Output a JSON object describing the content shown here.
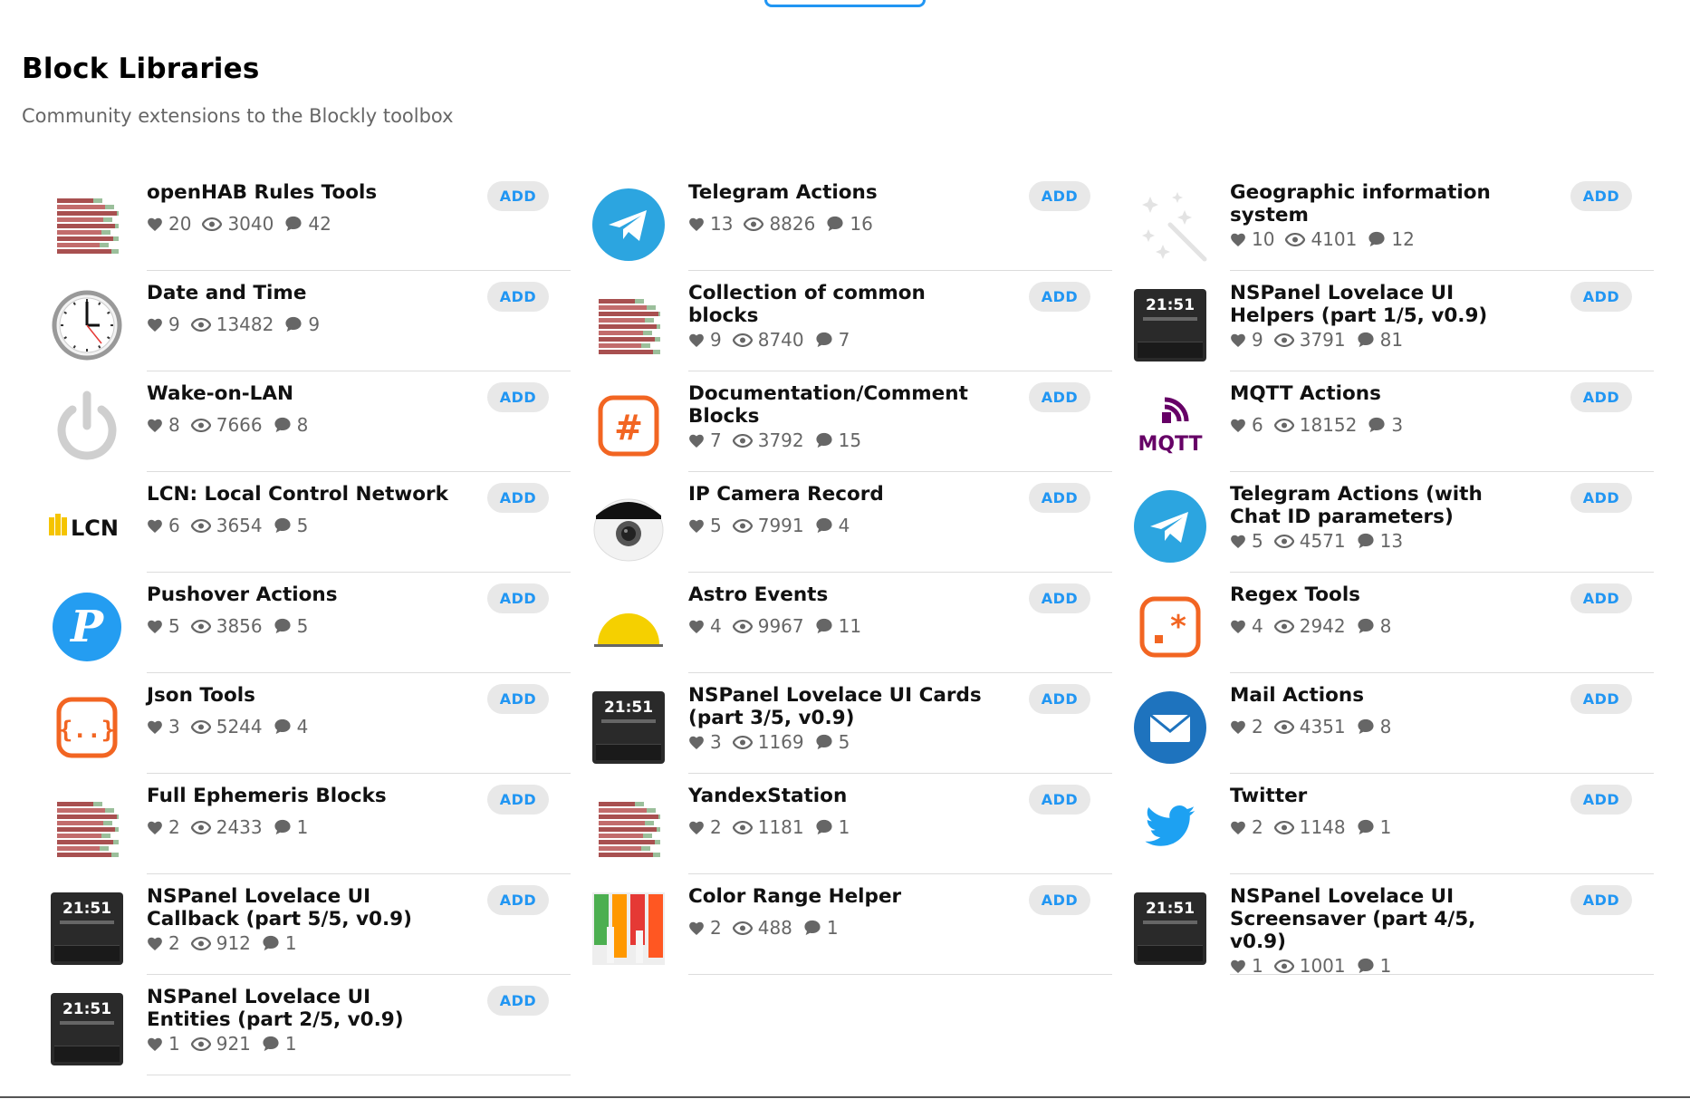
{
  "header": {
    "title": "Block Libraries",
    "subtitle": "Community extensions to the Blockly toolbox"
  },
  "add_label": "ADD",
  "columns": [
    [
      {
        "name": "openHAB Rules Tools",
        "likes": "20",
        "views": "3040",
        "comments": "42",
        "icon": "blocks-icon"
      },
      {
        "name": "Date and Time",
        "likes": "9",
        "views": "13482",
        "comments": "9",
        "icon": "clock-icon"
      },
      {
        "name": "Wake-on-LAN",
        "likes": "8",
        "views": "7666",
        "comments": "8",
        "icon": "power-icon"
      },
      {
        "name": "LCN: Local Control Network",
        "likes": "6",
        "views": "3654",
        "comments": "5",
        "icon": "lcn-logo-icon"
      },
      {
        "name": "Pushover Actions",
        "likes": "5",
        "views": "3856",
        "comments": "5",
        "icon": "pushover-icon"
      },
      {
        "name": "Json Tools",
        "likes": "3",
        "views": "5244",
        "comments": "4",
        "icon": "json-braces-icon"
      },
      {
        "name": "Full Ephemeris Blocks",
        "likes": "2",
        "views": "2433",
        "comments": "1",
        "icon": "blocks-icon"
      },
      {
        "name": "NSPanel Lovelace UI Callback (part 5/5, v0.9)",
        "likes": "2",
        "views": "912",
        "comments": "1",
        "icon": "nspanel-icon"
      },
      {
        "name": "NSPanel Lovelace UI Entities (part 2/5, v0.9)",
        "likes": "1",
        "views": "921",
        "comments": "1",
        "icon": "nspanel-icon"
      }
    ],
    [
      {
        "name": "Telegram Actions",
        "likes": "13",
        "views": "8826",
        "comments": "16",
        "icon": "telegram-icon"
      },
      {
        "name": "Collection of common blocks",
        "likes": "9",
        "views": "8740",
        "comments": "7",
        "icon": "blocks-icon"
      },
      {
        "name": "Documentation/Comment Blocks",
        "likes": "7",
        "views": "3792",
        "comments": "15",
        "icon": "hashtag-icon"
      },
      {
        "name": "IP Camera Record",
        "likes": "5",
        "views": "7991",
        "comments": "4",
        "icon": "camera-icon"
      },
      {
        "name": "Astro Events",
        "likes": "4",
        "views": "9967",
        "comments": "11",
        "icon": "sunrise-icon"
      },
      {
        "name": "NSPanel Lovelace UI Cards (part 3/5, v0.9)",
        "likes": "3",
        "views": "1169",
        "comments": "5",
        "icon": "nspanel-icon"
      },
      {
        "name": "YandexStation",
        "likes": "2",
        "views": "1181",
        "comments": "1",
        "icon": "blocks-icon"
      },
      {
        "name": "Color Range Helper",
        "likes": "2",
        "views": "488",
        "comments": "1",
        "icon": "paint-icon"
      }
    ],
    [
      {
        "name": "Geographic information system",
        "likes": "10",
        "views": "4101",
        "comments": "12",
        "icon": "magic-wand-icon"
      },
      {
        "name": "NSPanel Lovelace UI Helpers (part 1/5, v0.9)",
        "likes": "9",
        "views": "3791",
        "comments": "81",
        "icon": "nspanel-icon"
      },
      {
        "name": "MQTT Actions",
        "likes": "6",
        "views": "18152",
        "comments": "3",
        "icon": "mqtt-icon"
      },
      {
        "name": "Telegram Actions (with Chat ID parameters)",
        "likes": "5",
        "views": "4571",
        "comments": "13",
        "icon": "telegram-icon"
      },
      {
        "name": "Regex Tools",
        "likes": "4",
        "views": "2942",
        "comments": "8",
        "icon": "regex-icon"
      },
      {
        "name": "Mail Actions",
        "likes": "2",
        "views": "4351",
        "comments": "8",
        "icon": "mail-icon"
      },
      {
        "name": "Twitter",
        "likes": "2",
        "views": "1148",
        "comments": "1",
        "icon": "twitter-icon"
      },
      {
        "name": "NSPanel Lovelace UI Screensaver (part 4/5, v0.9)",
        "likes": "1",
        "views": "1001",
        "comments": "1",
        "icon": "nspanel-icon"
      }
    ]
  ],
  "nspanel_clock": "21:51",
  "lcn_text": "LCN",
  "mqtt_text": "MQTT",
  "colors": {
    "accent": "#2196f3",
    "muted": "#666666",
    "divider": "#dcdcdc",
    "button_bg": "#e8e8e8"
  }
}
